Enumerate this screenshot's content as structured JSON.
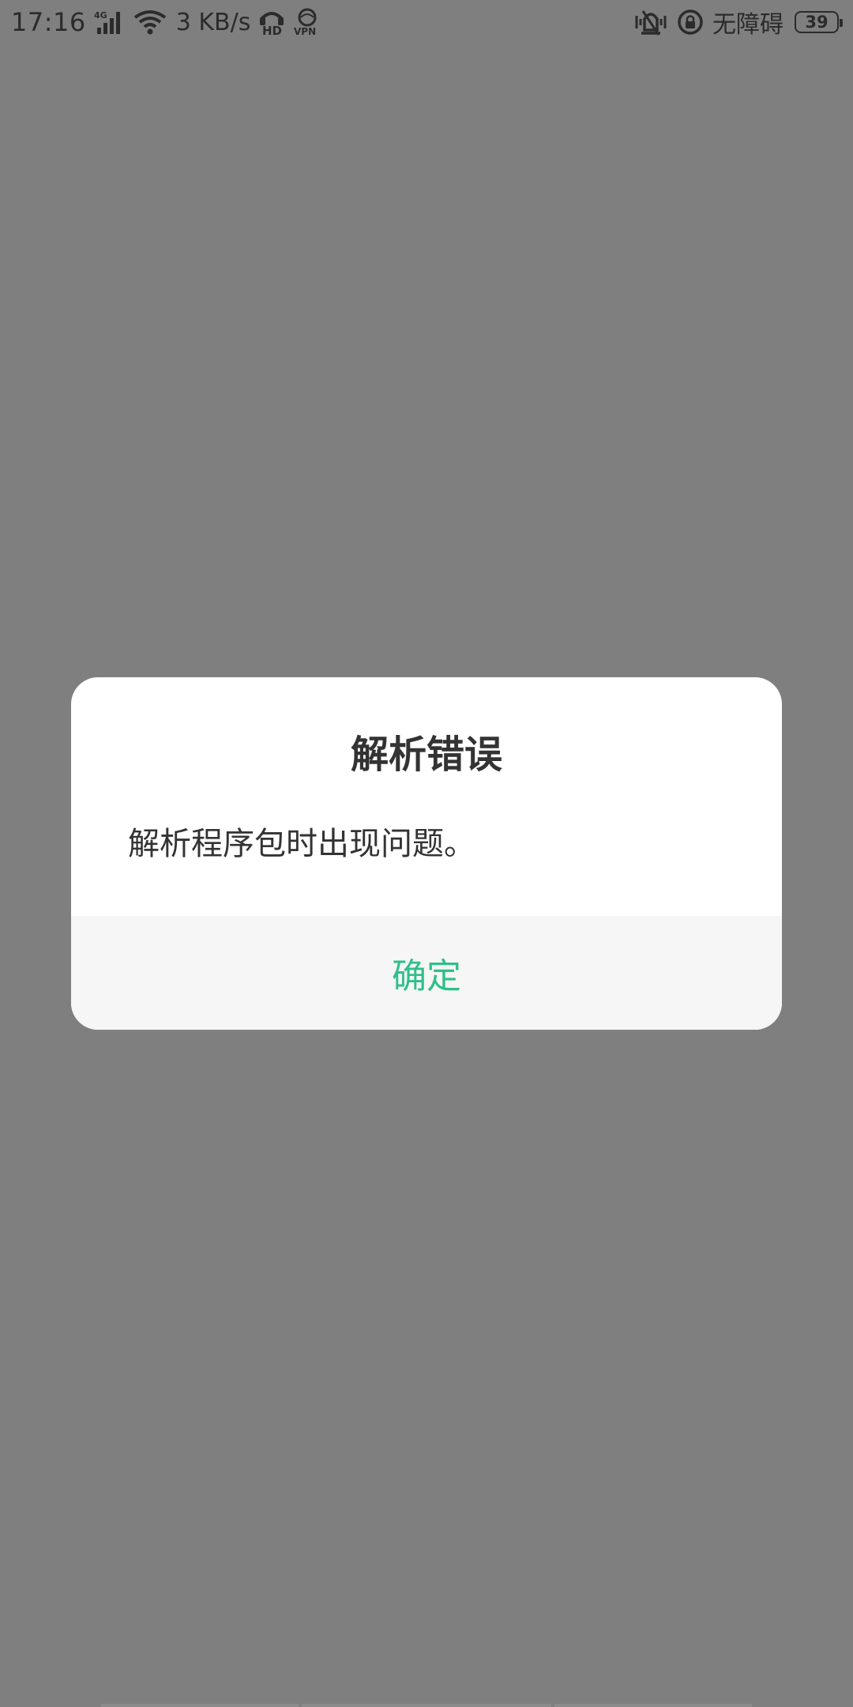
{
  "status_bar": {
    "time": "17:16",
    "network_type": "4G",
    "net_speed": "3 KB/s",
    "hd_label": "HD",
    "vpn_label": "VPN",
    "accessibility_text": "无障碍",
    "battery_level": "39",
    "icons": {
      "signal": "cellular-signal-icon",
      "wifi": "wifi-icon",
      "hd": "hd-voice-icon",
      "vpn": "vpn-icon",
      "vibrate": "vibrate-icon",
      "rotation_lock": "rotation-lock-icon",
      "battery": "battery-icon"
    }
  },
  "dialog": {
    "title": "解析错误",
    "message": "解析程序包时出现问题。",
    "confirm_label": "确定"
  },
  "colors": {
    "scrim": "#7f7f7f",
    "dialog_bg": "#ffffff",
    "footer_bg": "#f6f6f6",
    "text_primary": "#333333",
    "accent": "#2fbf8b"
  }
}
